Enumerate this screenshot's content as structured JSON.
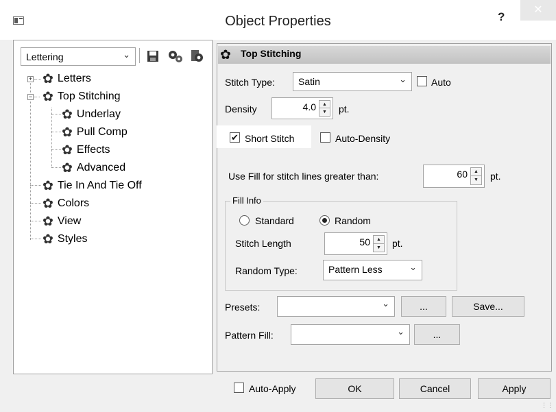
{
  "window": {
    "title": "Object Properties",
    "help_label": "?",
    "close_label": "✕"
  },
  "left": {
    "combo_value": "Lettering",
    "tree": [
      {
        "label": "Letters"
      },
      {
        "label": "Top Stitching"
      },
      {
        "label": "Underlay"
      },
      {
        "label": "Pull Comp"
      },
      {
        "label": "Effects"
      },
      {
        "label": "Advanced"
      },
      {
        "label": "Tie In And Tie Off"
      },
      {
        "label": "Colors"
      },
      {
        "label": "View"
      },
      {
        "label": "Styles"
      }
    ],
    "expander_plus": "+",
    "expander_minus": "−"
  },
  "section": {
    "title": "Top Stitching",
    "stitch_type_label": "Stitch Type:",
    "stitch_type_value": "Satin",
    "auto_label": "Auto",
    "density_label": "Density",
    "density_value": "4.0",
    "density_unit": "pt.",
    "short_stitch_label": "Short Stitch",
    "short_stitch_checked": "✔",
    "auto_density_label": "Auto-Density",
    "use_fill_label": "Use Fill for stitch lines greater than:",
    "use_fill_value": "60",
    "use_fill_unit": "pt.",
    "fill_info": {
      "title": "Fill Info",
      "standard_label": "Standard",
      "random_label": "Random",
      "stitch_length_label": "Stitch Length",
      "stitch_length_value": "50",
      "stitch_length_unit": "pt.",
      "random_type_label": "Random Type:",
      "random_type_value": "Pattern Less"
    },
    "presets_label": "Presets:",
    "presets_value": "",
    "presets_browse": "...",
    "save_label": "Save...",
    "pattern_fill_label": "Pattern Fill:",
    "pattern_fill_value": "",
    "pattern_browse": "..."
  },
  "footer": {
    "auto_apply_label": "Auto-Apply",
    "ok_label": "OK",
    "cancel_label": "Cancel",
    "apply_label": "Apply"
  },
  "icons": {
    "gear": "✿",
    "toolbar": [
      "save-icon",
      "gears-icon",
      "gear-doc-icon"
    ],
    "dropdown": "⌄"
  }
}
